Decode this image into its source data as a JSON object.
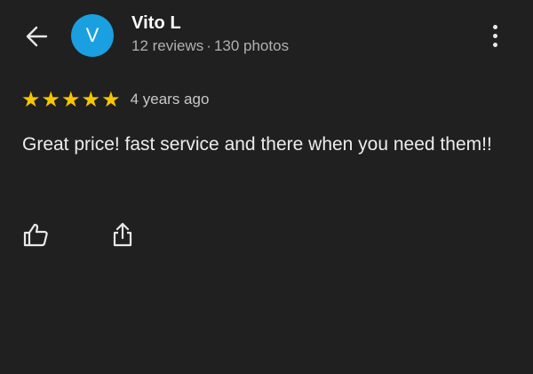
{
  "header": {
    "avatar_letter": "V",
    "avatar_color": "#1aa0e0",
    "name": "Vito L",
    "reviews": "12 reviews",
    "separator": "·",
    "photos": "130 photos"
  },
  "review": {
    "rating": 5,
    "max_rating": 5,
    "star_color": "#f7c600",
    "age": "4 years ago",
    "text": "Great price! fast service and there when you need them!!"
  },
  "icons": {
    "back": "arrow-left-icon",
    "more": "more-vertical-icon",
    "like": "thumbs-up-icon",
    "share": "share-icon"
  }
}
